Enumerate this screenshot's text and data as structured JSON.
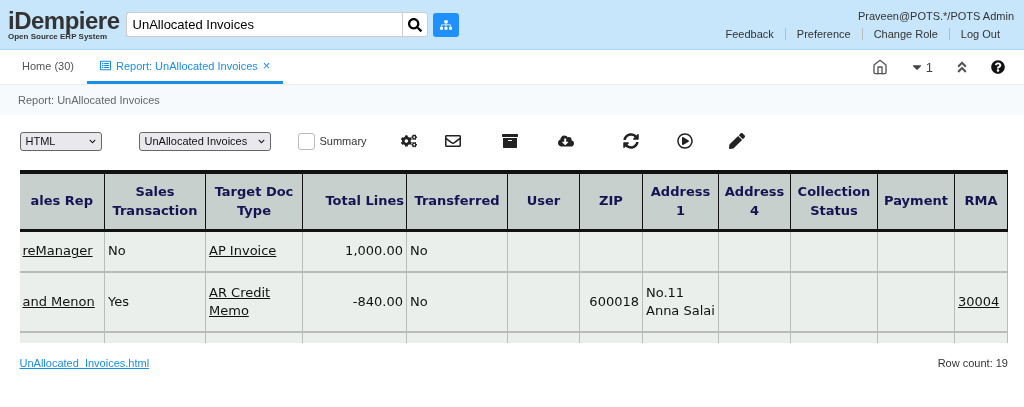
{
  "header": {
    "logo": "iDempiere",
    "logo_tagline": "Open Source ERP System",
    "search": {
      "value": "UnAllocated Invoices"
    },
    "user": "Praveen@POTS.*/POTS Admin",
    "links": [
      "Feedback",
      "Preference",
      "Change Role",
      "Log Out"
    ]
  },
  "tabs": [
    {
      "label": "Home (30)",
      "selected": false
    },
    {
      "label": "Report: UnAllocated Invoices",
      "selected": true,
      "close": "×"
    }
  ],
  "tab_tools": {
    "count": "1"
  },
  "breadcrumb": "Report: UnAllocated Invoices",
  "toolbar": {
    "format": "HTML",
    "print_format": "UnAllocated Invoices",
    "summary": {
      "label": "Summary",
      "checked": false
    }
  },
  "table": {
    "columns": [
      {
        "label": "ales Rep",
        "kind": "link"
      },
      {
        "label": "Sales Transaction",
        "kind": "text"
      },
      {
        "label": "Target Doc Type",
        "kind": "link"
      },
      {
        "label": "Total Lines",
        "kind": "number"
      },
      {
        "label": "Transferred",
        "kind": "text"
      },
      {
        "label": "User",
        "kind": "text"
      },
      {
        "label": "ZIP",
        "kind": "number"
      },
      {
        "label": "Address 1",
        "kind": "text"
      },
      {
        "label": "Address 4",
        "kind": "text"
      },
      {
        "label": "Collection Status",
        "kind": "text"
      },
      {
        "label": "Payment",
        "kind": "text"
      },
      {
        "label": "RMA",
        "kind": "link"
      }
    ],
    "rows": [
      {
        "cells": [
          "reManager",
          "No",
          "AP Invoice",
          "1,000.00",
          "No",
          null,
          null,
          null,
          null,
          null,
          null,
          null
        ]
      },
      {
        "cells": [
          "and Menon",
          "Yes",
          "AR Credit Memo",
          "-840.00",
          "No",
          null,
          "600018",
          "No.11 Anna Salai",
          null,
          null,
          null,
          "30004"
        ]
      },
      {
        "cells": [
          null,
          null,
          null,
          null,
          null,
          null,
          null,
          null,
          null,
          null,
          null,
          null
        ]
      }
    ]
  },
  "footer": {
    "file_link": "UnAllocated_Invoices.html",
    "row_count": "Row count: 19"
  }
}
